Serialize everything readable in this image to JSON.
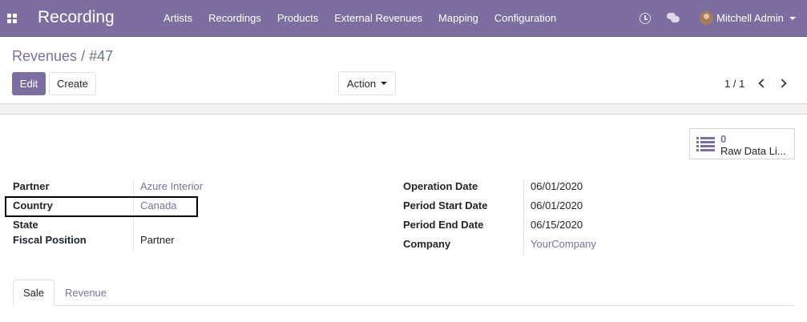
{
  "navbar": {
    "app_title": "Recording",
    "menu": [
      "Artists",
      "Recordings",
      "Products",
      "External Revenues",
      "Mapping",
      "Configuration"
    ],
    "user_name": "Mitchell Admin",
    "bg_color": "#7c6f9f"
  },
  "breadcrumb": {
    "parent": "Revenues",
    "separator": "/",
    "current": "#47"
  },
  "toolbar": {
    "edit_label": "Edit",
    "create_label": "Create",
    "action_label": "Action"
  },
  "pager": {
    "value": "1 / 1"
  },
  "smart_button": {
    "count": "0",
    "label": "Raw Data Li..."
  },
  "fields_left": [
    {
      "label": "Partner",
      "value": "Azure Interior",
      "is_link": true
    },
    {
      "label": "Country",
      "value": "Canada",
      "is_link": true
    },
    {
      "label": "State",
      "value": "",
      "is_link": false
    },
    {
      "label": "Fiscal Position",
      "value": "Partner",
      "is_link": false
    }
  ],
  "fields_right": [
    {
      "label": "Operation Date",
      "value": "06/01/2020",
      "is_link": false
    },
    {
      "label": "Period Start Date",
      "value": "06/01/2020",
      "is_link": false
    },
    {
      "label": "Period End Date",
      "value": "06/15/2020",
      "is_link": false
    },
    {
      "label": "Company",
      "value": "YourCompany",
      "is_link": true
    }
  ],
  "tabs": [
    "Sale",
    "Revenue"
  ],
  "icons": [
    "apps-icon",
    "clock-icon",
    "chat-icon",
    "avatar",
    "chevron-left-icon",
    "chevron-right-icon",
    "list-icon"
  ]
}
